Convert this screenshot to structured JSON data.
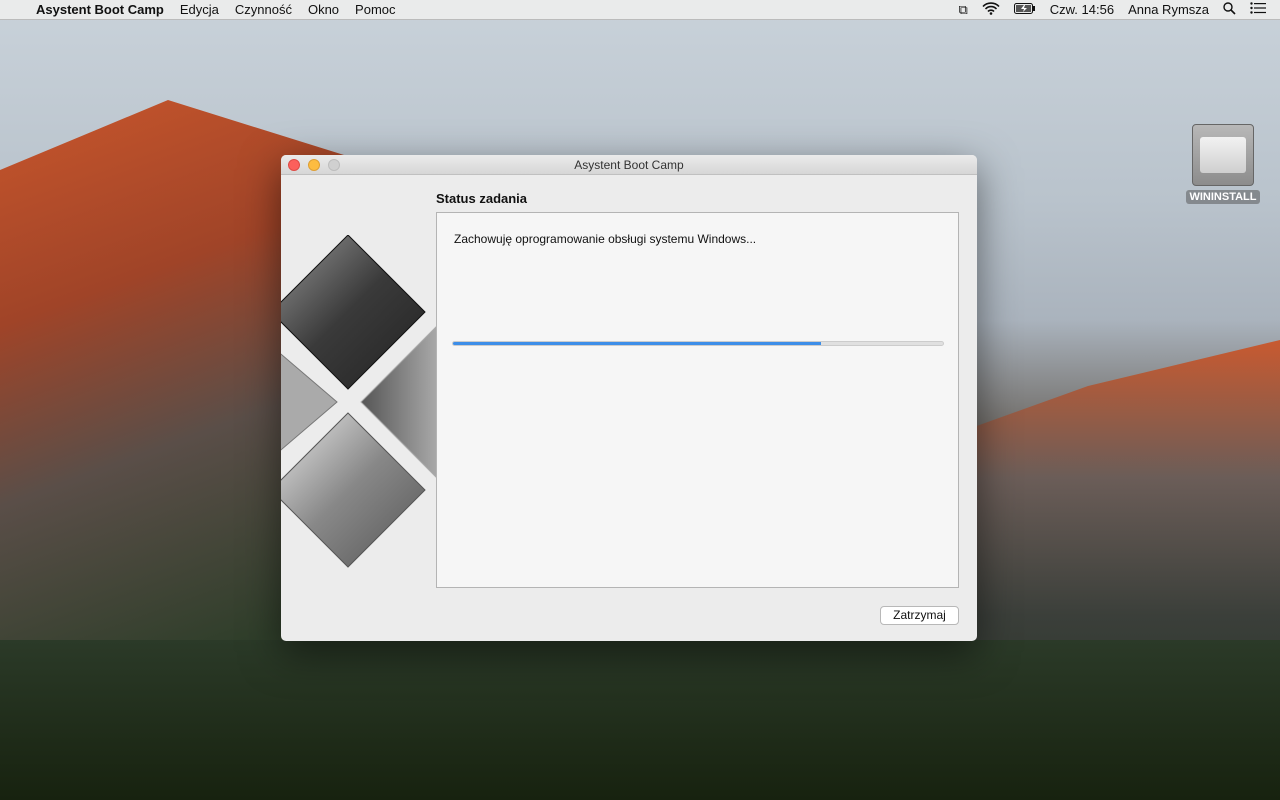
{
  "menubar": {
    "apple_icon": "apple-icon",
    "app": "Asystent Boot Camp",
    "items": [
      "Edycja",
      "Czynność",
      "Okno",
      "Pomoc"
    ],
    "status": {
      "clock": "Czw. 14:56",
      "user": "Anna Rymsza"
    }
  },
  "window": {
    "title": "Asystent Boot Camp",
    "heading": "Status zadania",
    "message": "Zachowuję oprogramowanie obsługi systemu Windows...",
    "progress": 0.75,
    "progress_color": "#3d8ee8",
    "stop_button": "Zatrzymaj"
  },
  "desktop": {
    "drive_label": "WININSTALL"
  }
}
